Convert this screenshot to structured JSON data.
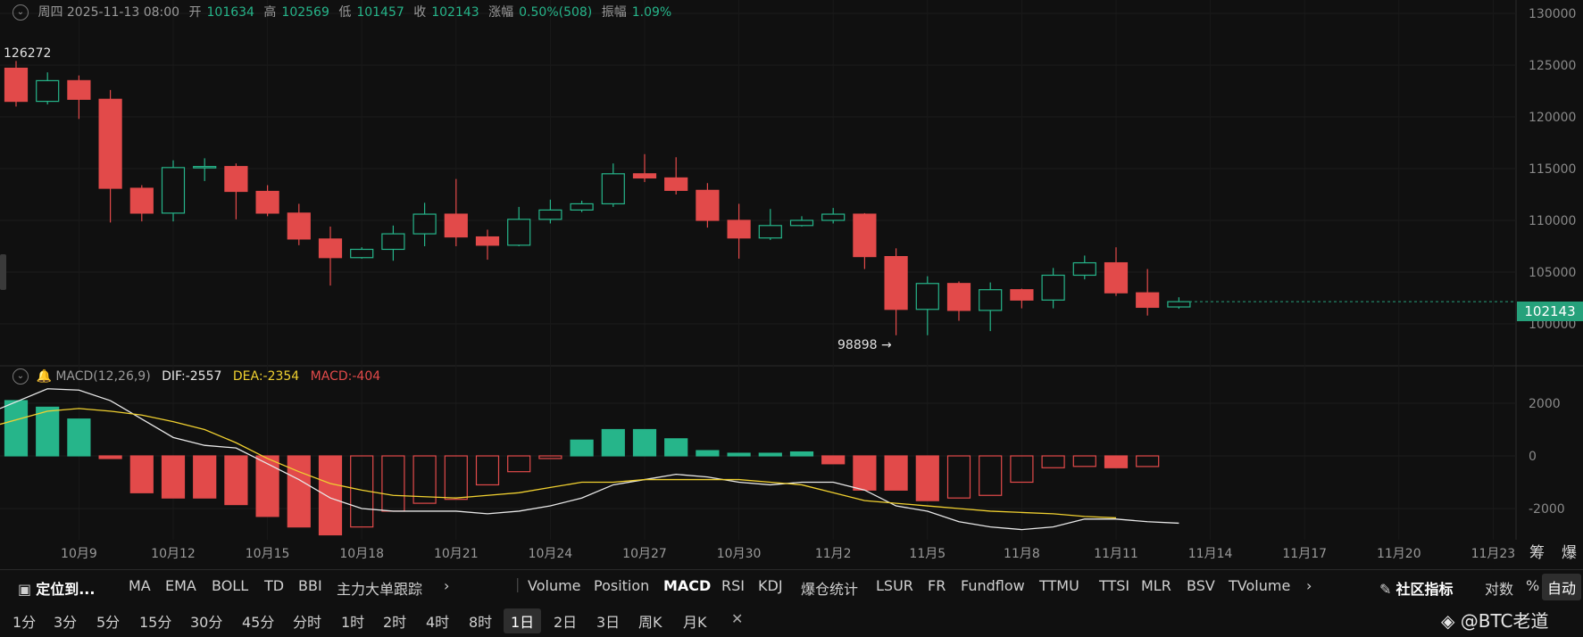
{
  "header": {
    "date": "周四 2025-11-13 08:00",
    "open_label": "开",
    "open": "101634",
    "high_label": "高",
    "high": "102569",
    "low_label": "低",
    "low": "101457",
    "close_label": "收",
    "close": "102143",
    "change_label": "涨幅",
    "change": "0.50%(508)",
    "amp_label": "振幅",
    "amp": "1.09%"
  },
  "annotations": {
    "max_label": "126272",
    "min_label": "98898 →"
  },
  "price_tag": "102143",
  "macd_header": {
    "name": "MACD(12,26,9)",
    "dif": "DIF:-2557",
    "dea": "DEA:-2354",
    "macd": "MACD:-404"
  },
  "chart_data": [
    {
      "type": "candlestick",
      "title": "",
      "y_ticks": [
        100000,
        105000,
        110000,
        115000,
        120000,
        125000,
        130000
      ],
      "ylim": [
        96000,
        130500
      ],
      "x_tick_labels": [
        "10月9",
        "10月12",
        "10月15",
        "10月18",
        "10月21",
        "10月24",
        "10月27",
        "10月30",
        "11月2",
        "11月5",
        "11月8",
        "11月11",
        "11月14",
        "11月17",
        "11月20",
        "11月23"
      ],
      "colors": {
        "up": "#26b58a",
        "down": "#e24a4a"
      },
      "candles": [
        {
          "d": "10月7",
          "o": 124700,
          "h": 125400,
          "l": 121000,
          "c": 121500
        },
        {
          "d": "10月8",
          "o": 121500,
          "h": 124300,
          "l": 121200,
          "c": 123500
        },
        {
          "d": "10月9",
          "o": 123500,
          "h": 124000,
          "l": 119800,
          "c": 121700
        },
        {
          "d": "10月10",
          "o": 121700,
          "h": 122600,
          "l": 109800,
          "c": 113100
        },
        {
          "d": "10月11",
          "o": 113100,
          "h": 113400,
          "l": 109900,
          "c": 110700
        },
        {
          "d": "10月12",
          "o": 110700,
          "h": 115800,
          "l": 109900,
          "c": 115100
        },
        {
          "d": "10月13",
          "o": 115100,
          "h": 116000,
          "l": 113800,
          "c": 115200
        },
        {
          "d": "10月14",
          "o": 115200,
          "h": 115500,
          "l": 110100,
          "c": 112800
        },
        {
          "d": "10月15",
          "o": 112800,
          "h": 113400,
          "l": 110400,
          "c": 110700
        },
        {
          "d": "10月16",
          "o": 110700,
          "h": 111600,
          "l": 107600,
          "c": 108200
        },
        {
          "d": "10月17",
          "o": 108200,
          "h": 109400,
          "l": 103700,
          "c": 106400
        },
        {
          "d": "10月18",
          "o": 106400,
          "h": 107400,
          "l": 106300,
          "c": 107200
        },
        {
          "d": "10月19",
          "o": 107200,
          "h": 109500,
          "l": 106100,
          "c": 108700
        },
        {
          "d": "10月20",
          "o": 108700,
          "h": 111700,
          "l": 107500,
          "c": 110600
        },
        {
          "d": "10月21",
          "o": 110600,
          "h": 114000,
          "l": 107500,
          "c": 108400
        },
        {
          "d": "10月22",
          "o": 108400,
          "h": 109100,
          "l": 106200,
          "c": 107600
        },
        {
          "d": "10月23",
          "o": 107600,
          "h": 111300,
          "l": 107500,
          "c": 110100
        },
        {
          "d": "10月24",
          "o": 110100,
          "h": 112000,
          "l": 109700,
          "c": 111000
        },
        {
          "d": "10月25",
          "o": 111000,
          "h": 111900,
          "l": 110800,
          "c": 111600
        },
        {
          "d": "10月26",
          "o": 111600,
          "h": 115500,
          "l": 111300,
          "c": 114500
        },
        {
          "d": "10月27",
          "o": 114500,
          "h": 116400,
          "l": 113700,
          "c": 114100
        },
        {
          "d": "10月28",
          "o": 114100,
          "h": 116100,
          "l": 112500,
          "c": 112900
        },
        {
          "d": "10月29",
          "o": 112900,
          "h": 113600,
          "l": 109300,
          "c": 110000
        },
        {
          "d": "10月30",
          "o": 110000,
          "h": 111600,
          "l": 106300,
          "c": 108300
        },
        {
          "d": "10月31",
          "o": 108300,
          "h": 111100,
          "l": 108100,
          "c": 109500
        },
        {
          "d": "11月1",
          "o": 109500,
          "h": 110400,
          "l": 109400,
          "c": 110000
        },
        {
          "d": "11月2",
          "o": 110000,
          "h": 111200,
          "l": 109700,
          "c": 110600
        },
        {
          "d": "11月3",
          "o": 110600,
          "h": 110700,
          "l": 105300,
          "c": 106500
        },
        {
          "d": "11月4",
          "o": 106500,
          "h": 107300,
          "l": 98900,
          "c": 101400
        },
        {
          "d": "11月5",
          "o": 101400,
          "h": 104600,
          "l": 98900,
          "c": 103900
        },
        {
          "d": "11月6",
          "o": 103900,
          "h": 104100,
          "l": 100300,
          "c": 101300
        },
        {
          "d": "11月7",
          "o": 101300,
          "h": 104000,
          "l": 99300,
          "c": 103300
        },
        {
          "d": "11月8",
          "o": 103300,
          "h": 103400,
          "l": 101500,
          "c": 102300
        },
        {
          "d": "11月9",
          "o": 102300,
          "h": 105400,
          "l": 101500,
          "c": 104700
        },
        {
          "d": "11月10",
          "o": 104700,
          "h": 106600,
          "l": 104300,
          "c": 105900
        },
        {
          "d": "11月11",
          "o": 105900,
          "h": 107400,
          "l": 102700,
          "c": 103000
        },
        {
          "d": "11月12",
          "o": 103000,
          "h": 105300,
          "l": 100800,
          "c": 101600
        },
        {
          "d": "11月13",
          "o": 101634,
          "h": 102569,
          "l": 101457,
          "c": 102143
        }
      ]
    },
    {
      "type": "bar+line",
      "title": "MACD(12,26,9)",
      "y_ticks": [
        -2000,
        0,
        2000
      ],
      "ylim": [
        -3200,
        2700
      ],
      "histogram": [
        2100,
        1850,
        1400,
        -100,
        -1400,
        -1600,
        -1600,
        -1850,
        -2300,
        -2700,
        -3000,
        -2700,
        -2100,
        -1800,
        -1650,
        -1100,
        -600,
        -100,
        600,
        1000,
        1000,
        650,
        200,
        100,
        100,
        150,
        -300,
        -1300,
        -1300,
        -1700,
        -1600,
        -1500,
        -1000,
        -450,
        -400,
        -450,
        -404
      ],
      "dif": [
        1800,
        2550,
        2500,
        2100,
        1400,
        700,
        400,
        300,
        -300,
        -900,
        -1600,
        -2000,
        -2100,
        -2100,
        -2100,
        -2200,
        -2100,
        -1900,
        -1600,
        -1100,
        -900,
        -700,
        -800,
        -1000,
        -1100,
        -1000,
        -1000,
        -1300,
        -1900,
        -2100,
        -2500,
        -2700,
        -2800,
        -2700,
        -2400,
        -2400,
        -2500,
        -2557
      ],
      "dea": [
        1200,
        1700,
        1800,
        1700,
        1550,
        1300,
        1000,
        500,
        -100,
        -600,
        -1050,
        -1300,
        -1500,
        -1550,
        -1600,
        -1500,
        -1400,
        -1200,
        -1000,
        -1000,
        -900,
        -900,
        -900,
        -900,
        -1000,
        -1100,
        -1400,
        -1700,
        -1800,
        -1900,
        -2000,
        -2100,
        -2150,
        -2200,
        -2300,
        -2354
      ],
      "colors": {
        "dif": "#e8e8e8",
        "dea": "#f0d030"
      }
    }
  ],
  "toolbar_top": {
    "locate": "定位到...",
    "main_indicators": [
      "MA",
      "EMA",
      "BOLL",
      "TD",
      "BBI",
      "主力大单跟踪"
    ],
    "sub_indicators": [
      "Volume",
      "Position",
      "MACD",
      "RSI",
      "KDJ",
      "爆仓统计",
      "LSUR",
      "FR",
      "Fundflow",
      "TTMU",
      "TTSI",
      "MLR",
      "BSV",
      "TVolume"
    ],
    "active_sub": "MACD",
    "community": "社区指标",
    "log": "对数",
    "pct": "%",
    "auto": "自动"
  },
  "toolbar_bottom": {
    "intervals": [
      "1分",
      "3分",
      "5分",
      "15分",
      "30分",
      "45分",
      "分时",
      "1时",
      "2时",
      "4时",
      "8时",
      "1日",
      "2日",
      "3日",
      "周K",
      "月K"
    ],
    "selected": "1日",
    "close": "✕",
    "watermark": "@BTC老道"
  },
  "side_labels": {
    "chip": "筹",
    "liq": "爆"
  }
}
